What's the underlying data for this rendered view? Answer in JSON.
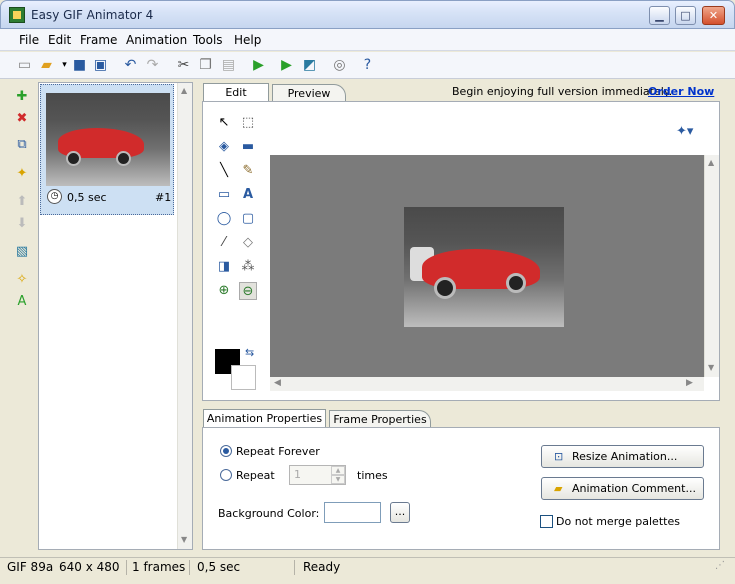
{
  "window": {
    "title": "Easy GIF Animator 4",
    "minimize": "▁",
    "maximize": "□",
    "close": "✕"
  },
  "menu": [
    "File",
    "Edit",
    "Frame",
    "Animation",
    "Tools",
    "Help"
  ],
  "frames": [
    {
      "delay": "0,5 sec",
      "index": "#1"
    }
  ],
  "tabs": {
    "edit": "Edit",
    "preview": "Preview"
  },
  "promo": {
    "text": "Begin enjoying full version immediately.",
    "link": "Order Now"
  },
  "props_tabs": {
    "animation": "Animation Properties",
    "frame": "Frame Properties"
  },
  "animation_props": {
    "repeat_forever": "Repeat Forever",
    "repeat": "Repeat",
    "repeat_count": "1",
    "times": "times",
    "background_color_label": "Background Color:",
    "browse_button": "...",
    "resize_button": "Resize Animation...",
    "comment_button": "Animation Comment...",
    "merge_palettes": "Do not merge palettes",
    "repeat_forever_selected": true,
    "merge_palettes_checked": false
  },
  "status": {
    "format": "GIF 89a",
    "size": "640 x 480",
    "frames": "1 frames",
    "duration": "0,5 sec",
    "state": "Ready"
  },
  "colors": {
    "foreground": "#000000",
    "background": "#ffffff",
    "canvas": "#7b7b7b",
    "link": "#0033cc",
    "selection": "#cde0f3"
  }
}
